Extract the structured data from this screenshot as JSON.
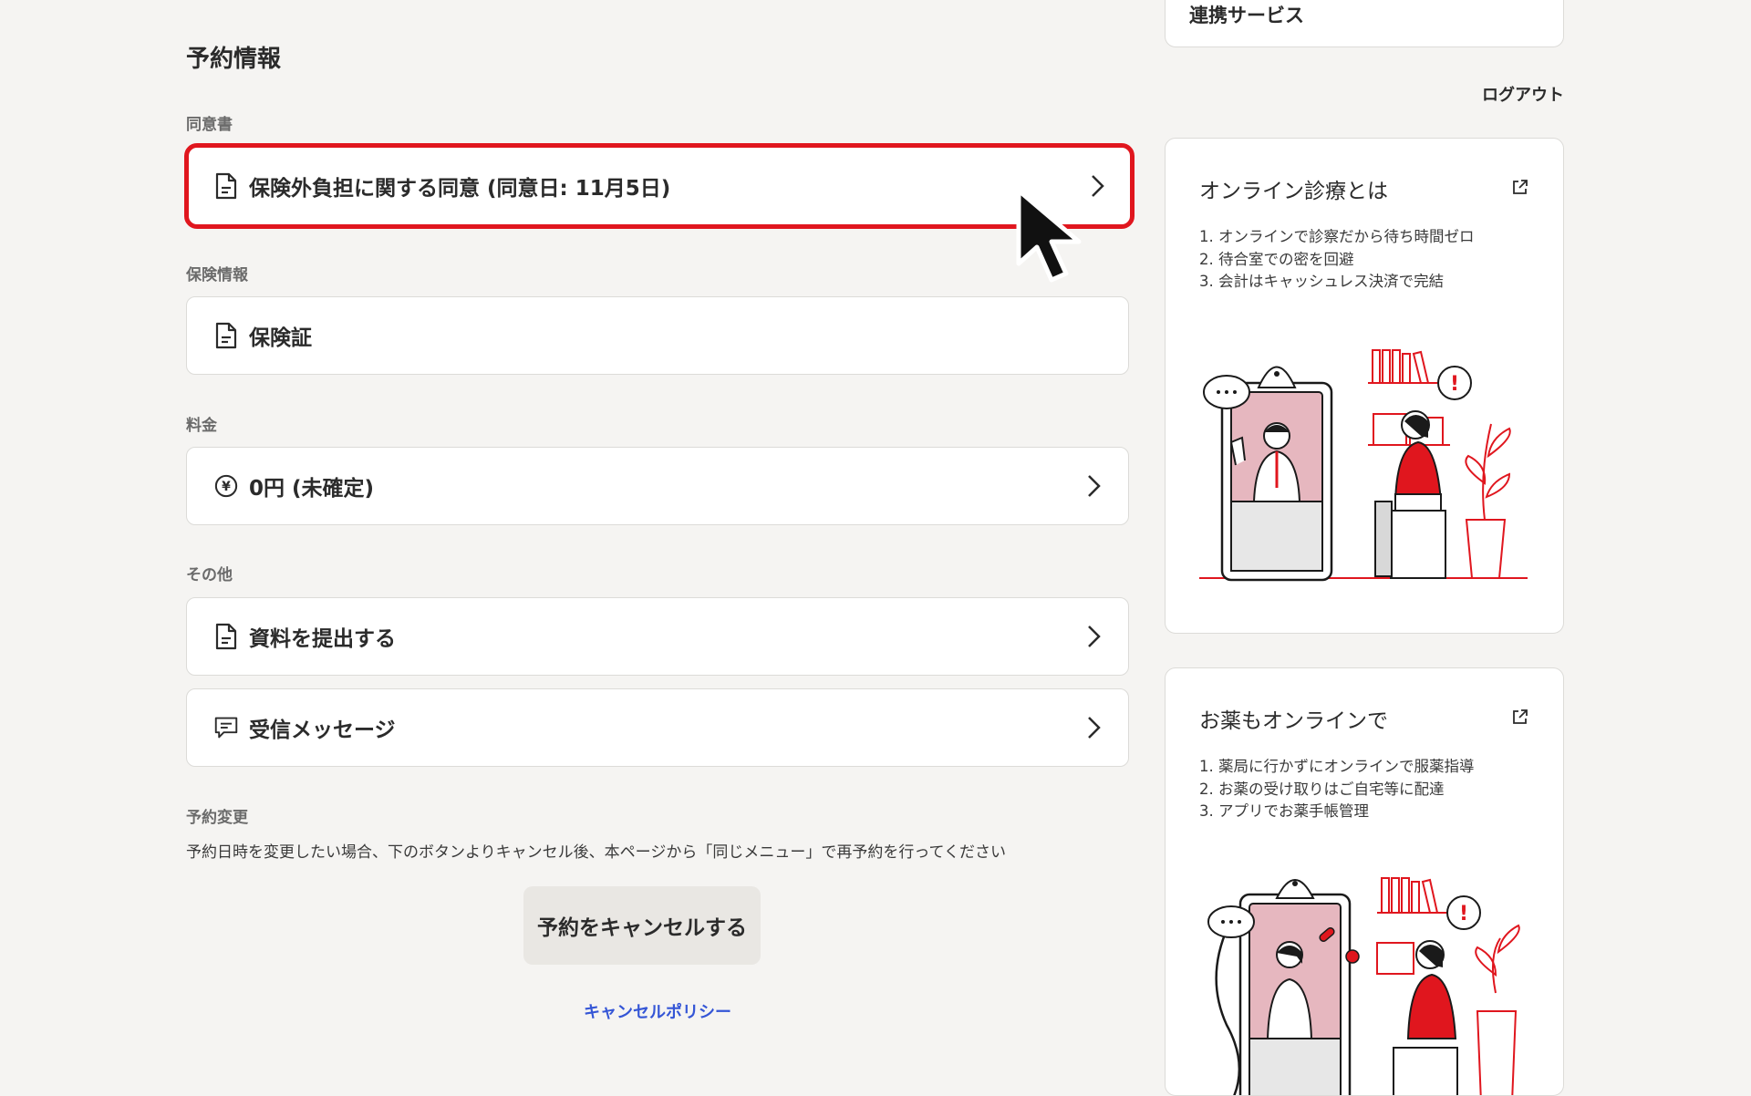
{
  "main": {
    "title": "予約情報",
    "sections": {
      "consent_label": "同意書",
      "consent_item": "保険外負担に関する同意 (同意日: 11月5日)",
      "insurance_label": "保険情報",
      "insurance_item": "保険証",
      "fee_label": "料金",
      "fee_item": "0円 (未確定)",
      "other_label": "その他",
      "submit_item": "資料を提出する",
      "messages_item": "受信メッセージ"
    },
    "change": {
      "label": "予約変更",
      "note": "予約日時を変更したい場合、下のボタンよりキャンセル後、本ページから「同じメニュー」で再予約を行ってください",
      "cancel_button": "予約をキャンセルする",
      "policy_link": "キャンセルポリシー"
    }
  },
  "sidebar": {
    "linked_services": "連携サービス",
    "logout": "ログアウト",
    "cards": [
      {
        "title": "オンライン診療とは",
        "items": [
          "1. オンラインで診察だから待ち時間ゼロ",
          "2. 待合室での密を回避",
          "3. 会計はキャッシュレス決済で完結"
        ]
      },
      {
        "title": "お薬もオンラインで",
        "items": [
          "1. 薬局に行かずにオンラインで服薬指導",
          "2. お薬の受け取りはご自宅等に配達",
          "3. アプリでお薬手帳管理"
        ]
      }
    ]
  },
  "colors": {
    "accent_red": "#e0161e",
    "link_blue": "#3556d6",
    "background": "#f5f4f2",
    "card_bg": "#ffffff"
  },
  "icons": [
    "document-icon",
    "yen-icon",
    "message-icon",
    "chevron-right-icon",
    "external-link-icon",
    "mouse-cursor-icon"
  ]
}
